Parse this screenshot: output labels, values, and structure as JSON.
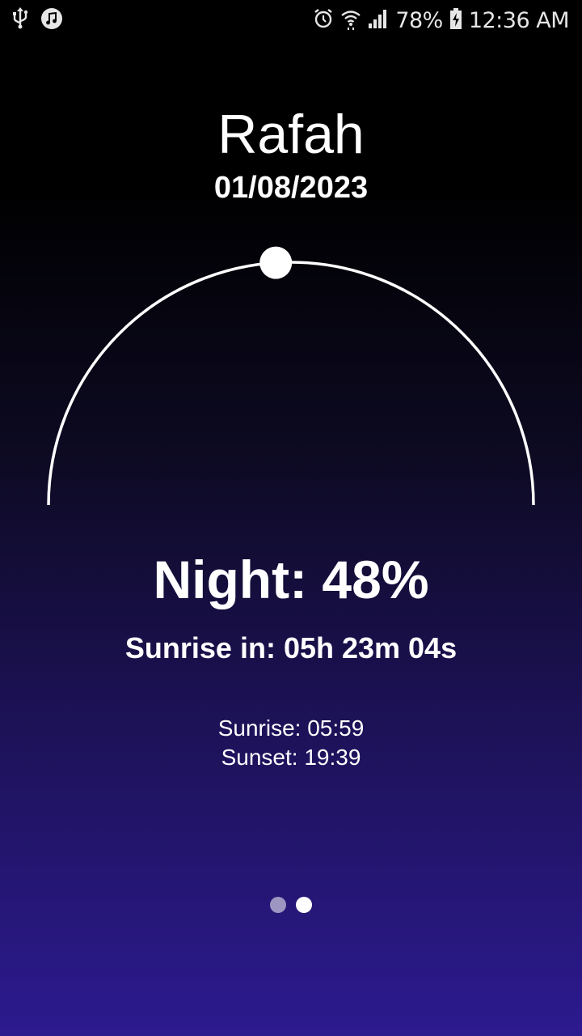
{
  "status_bar": {
    "battery_level": "78%",
    "clock": "12:36 AM",
    "icons_left": [
      "usb-icon",
      "music-icon"
    ],
    "icons_right": [
      "alarm-icon",
      "wifi-icon",
      "signal-icon",
      "battery-charging-icon"
    ]
  },
  "location": {
    "city": "Rafah",
    "date": "01/08/2023"
  },
  "sun_arc": {
    "progress": 0.48
  },
  "info": {
    "phase_label": "Night: 48%",
    "countdown": "Sunrise in: 05h 23m 04s",
    "sunrise": "Sunrise: 05:59",
    "sunset": "Sunset: 19:39"
  },
  "pager": {
    "pages": 2,
    "active_index": 1
  },
  "colors": {
    "background_top": "#000000",
    "background_bottom": "#2c1a8f",
    "foreground": "#ffffff"
  }
}
